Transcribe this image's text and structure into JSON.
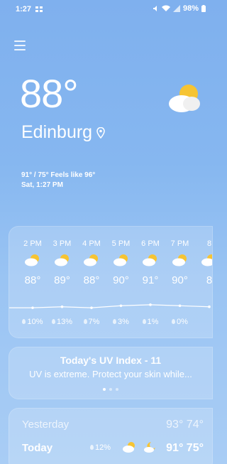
{
  "status": {
    "time": "1:27",
    "battery": "98%"
  },
  "location": {
    "temperature": "88°",
    "city": "Edinburg",
    "high_low_feels": "91° / 75° Feels like 96°",
    "datetime": "Sat, 1:27 PM"
  },
  "hourly": [
    {
      "time": "2 PM",
      "temp": "88°",
      "precip": "10%",
      "icon": "partly-cloudy-icon",
      "level": 88
    },
    {
      "time": "3 PM",
      "temp": "89°",
      "precip": "13%",
      "icon": "partly-cloudy-icon",
      "level": 89
    },
    {
      "time": "4 PM",
      "temp": "88°",
      "precip": "7%",
      "icon": "partly-cloudy-icon",
      "level": 88
    },
    {
      "time": "5 PM",
      "temp": "90°",
      "precip": "3%",
      "icon": "partly-cloudy-icon",
      "level": 90
    },
    {
      "time": "6 PM",
      "temp": "91°",
      "precip": "1%",
      "icon": "partly-cloudy-icon",
      "level": 91
    },
    {
      "time": "7 PM",
      "temp": "90°",
      "precip": "0%",
      "icon": "partly-cloudy-icon",
      "level": 90
    },
    {
      "time": "8",
      "temp": "8",
      "precip": "",
      "icon": "partly-cloudy-icon",
      "level": 89
    }
  ],
  "uv": {
    "title": "Today's UV Index - 11",
    "description": "UV is extreme. Protect your skin while..."
  },
  "daily": {
    "yesterday": {
      "label": "Yesterday",
      "temps": "93° 74°"
    },
    "today": {
      "label": "Today",
      "precip": "12%",
      "day_icon": "partly-cloudy-icon",
      "night_icon": "moon-cloud-icon",
      "temps": "91° 75°"
    }
  },
  "colors": {
    "background_top": "#7fb0ee",
    "sun": "#f6c433",
    "cloud": "#ffffff"
  }
}
